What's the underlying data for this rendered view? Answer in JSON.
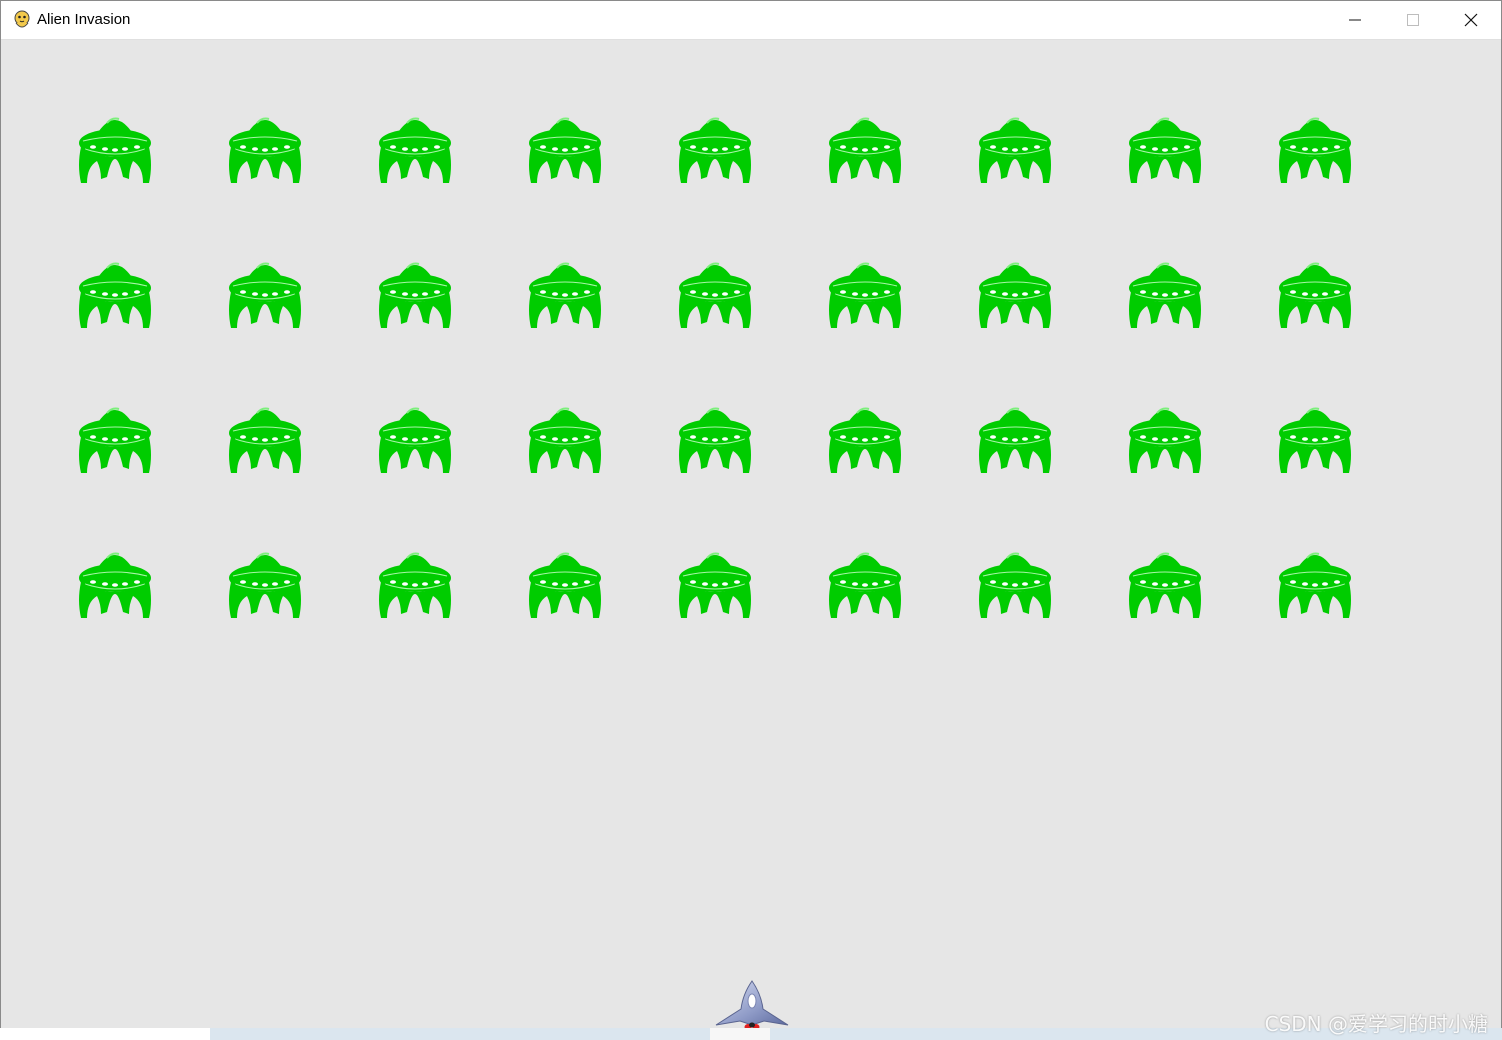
{
  "window": {
    "title": "Alien Invasion",
    "controls": [
      "minimize",
      "maximize",
      "close"
    ]
  },
  "game": {
    "background_color": "#e6e6e6",
    "alien_color": "#00cc00",
    "fleet": {
      "rows": 4,
      "columns": 9
    }
  },
  "watermark": "CSDN @爱学习的时小糖"
}
